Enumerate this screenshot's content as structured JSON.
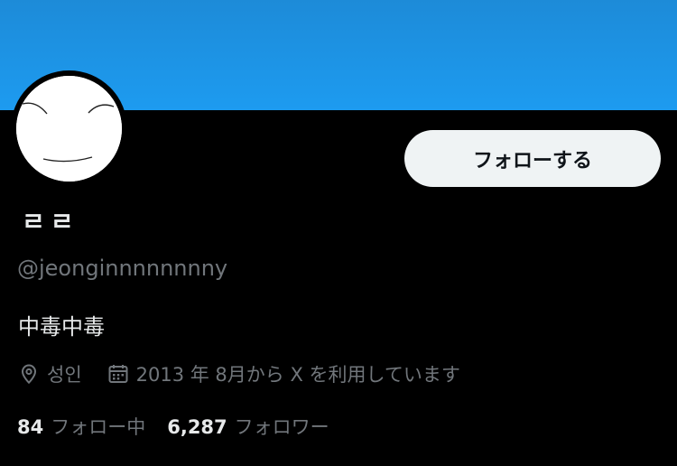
{
  "profile": {
    "display_name": "ㄹㄹ",
    "handle": "@jeonginnnnnnnny",
    "bio": "中毒中毒",
    "location": "성인",
    "joined": "2013 年 8月から X を利用しています"
  },
  "actions": {
    "follow_label": "フォローする"
  },
  "stats": {
    "following_count": "84",
    "following_label": "フォロー中",
    "followers_count": "6,287",
    "followers_label": "フォロワー"
  },
  "icons": {
    "location": "location-pin-icon",
    "joined": "calendar-icon"
  },
  "colors": {
    "banner": "#1d9bf0",
    "background": "#000000",
    "button_bg": "#eff3f4",
    "primary_text": "#e7e9ea",
    "secondary_text": "#71767b"
  }
}
